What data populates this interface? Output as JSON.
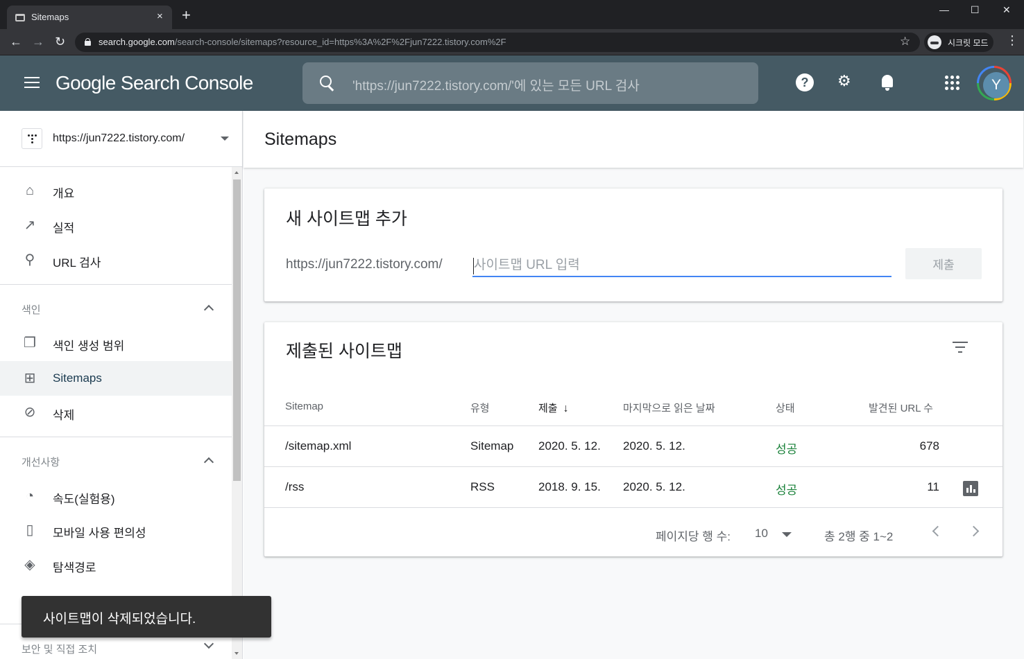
{
  "browser": {
    "tab_title": "Sitemaps",
    "tab_close": "×",
    "new_tab": "+",
    "win_min": "—",
    "win_max": "☐",
    "win_close": "✕",
    "back": "←",
    "forward": "→",
    "reload": "↻",
    "url_host": "search.google.com",
    "url_path": "/search-console/sitemaps?resource_id=https%3A%2F%2Fjun7222.tistory.com%2F",
    "star": "☆",
    "incognito_label": "시크릿 모드",
    "menu": "⋮"
  },
  "header": {
    "logo_text": "Google Search Console",
    "search_placeholder": "'https://jun7222.tistory.com/'에 있는 모든 URL 검사",
    "help": "?",
    "admin": "⚙",
    "avatar_letter": "Y"
  },
  "sidebar": {
    "property_url": "https://jun7222.tistory.com/",
    "items_top": [
      {
        "icon": "home-icon",
        "glyph": "⌂",
        "label": "개요"
      },
      {
        "icon": "trending-up-icon",
        "glyph": "↗",
        "label": "실적"
      },
      {
        "icon": "search-icon",
        "glyph": "⚲",
        "label": "URL 검사"
      }
    ],
    "section_index": "색인",
    "items_index": [
      {
        "icon": "copy-pages-icon",
        "glyph": "❐",
        "label": "색인 생성 범위"
      },
      {
        "icon": "sitemap-icon",
        "glyph": "⊞",
        "label": "Sitemaps"
      },
      {
        "icon": "visibility-off-icon",
        "glyph": "⊘",
        "label": "삭제"
      }
    ],
    "section_enhancements": "개선사항",
    "items_enh": [
      {
        "icon": "speed-icon",
        "glyph": "◔",
        "label": "속도(실험용)"
      },
      {
        "icon": "mobile-icon",
        "glyph": "▯",
        "label": "모바일 사용 편의성"
      },
      {
        "icon": "layers-icon",
        "glyph": "◈",
        "label": "탐색경로"
      }
    ],
    "section_security": "보안 및 직접 조치"
  },
  "main": {
    "page_title": "Sitemaps",
    "add_card": {
      "title": "새 사이트맵 추가",
      "prefix": "https://jun7222.tistory.com/",
      "input_placeholder": "사이트맵 URL 입력",
      "input_value": "",
      "submit_label": "제출"
    },
    "list_card": {
      "title": "제출된 사이트맵",
      "columns": [
        "Sitemap",
        "유형",
        "제출",
        "마지막으로 읽은 날짜",
        "상태",
        "발견된 URL 수"
      ],
      "sort_arrow": "↓",
      "rows": [
        {
          "sitemap": "/sitemap.xml",
          "type": "Sitemap",
          "submitted": "2020. 5. 12.",
          "last_read": "2020. 5. 12.",
          "status": "성공",
          "urls": "678"
        },
        {
          "sitemap": "/rss",
          "type": "RSS",
          "submitted": "2018. 9. 15.",
          "last_read": "2020. 5. 12.",
          "status": "성공",
          "urls": "11"
        }
      ],
      "rows_per_page_label": "페이지당 행 수:",
      "rows_per_page": "10",
      "range": "총 2행 중 1~2"
    }
  },
  "snackbar": {
    "message": "사이트맵이 삭제되었습니다."
  },
  "colors": {
    "header_bg": "#455a64",
    "success": "#188038",
    "accent": "#4285f4"
  }
}
